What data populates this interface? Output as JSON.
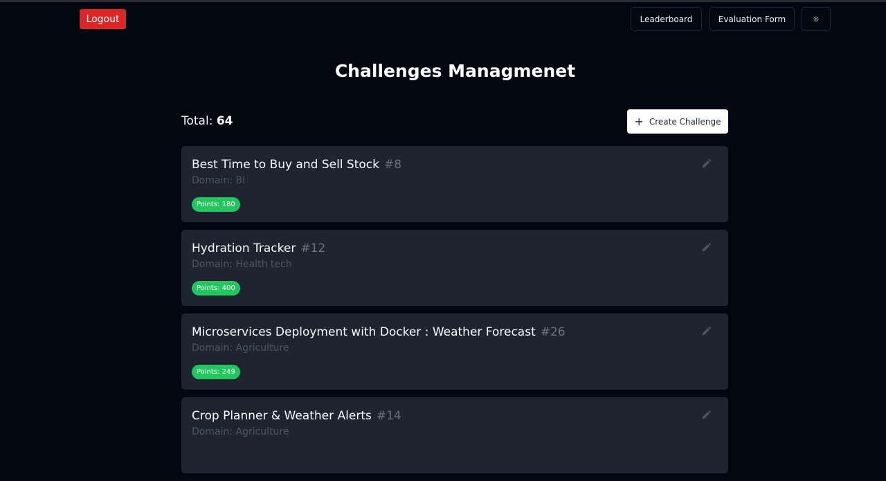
{
  "header": {
    "logout_label": "Logout",
    "leaderboard_label": "Leaderboard",
    "evaluation_label": "Evaluation Form",
    "theme_icon": "sun-icon",
    "theme_glyph": "☼"
  },
  "page": {
    "title": "Challenges Managmenet",
    "total_label": "Total:",
    "total_value": "64",
    "create_plus": "+",
    "create_label": "Create Challenge"
  },
  "challenges": [
    {
      "title": "Best Time to Buy and Sell Stock",
      "id": "#8",
      "domain_label": "Domain:",
      "domain": "BI",
      "points_label": "Points:",
      "points": "180"
    },
    {
      "title": "Hydration Tracker",
      "id": "#12",
      "domain_label": "Domain:",
      "domain": "Health tech",
      "points_label": "Points:",
      "points": "400"
    },
    {
      "title": "Microservices Deployment with Docker : Weather Forecast",
      "id": "#26",
      "domain_label": "Domain:",
      "domain": "Agriculture",
      "points_label": "Points:",
      "points": "249"
    },
    {
      "title": "Crop Planner & Weather Alerts",
      "id": "#14",
      "domain_label": "Domain:",
      "domain": "Agriculture",
      "points_label": "Points:",
      "points": ""
    }
  ],
  "colors": {
    "background": "#030712",
    "card": "#1f2530",
    "logout": "#dc2626",
    "points_badge": "#22c55e"
  }
}
